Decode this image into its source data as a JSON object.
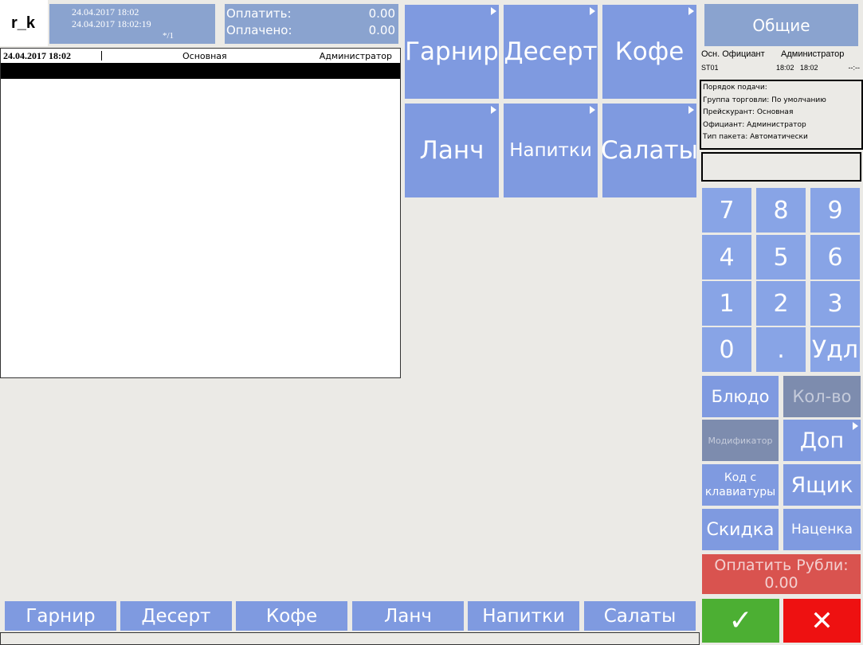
{
  "header": {
    "logo": "r_k",
    "time_opened": "24.04.2017 18:02",
    "time_current": "24.04.2017 18:02:19",
    "guests": "*/1",
    "to_pay_label": "Оплатить:",
    "to_pay_value": "0.00",
    "paid_label": "Оплачено:",
    "paid_value": "0.00"
  },
  "order": {
    "date": "24.04.2017 18:02",
    "price_list": "Основная",
    "waiter": "Администратор"
  },
  "categories": [
    "Гарнир",
    "Десерт",
    "Кофе",
    "Ланч",
    "Напитки",
    "Салаты"
  ],
  "bottom_tabs": [
    "Гарнир",
    "Десерт",
    "Кофе",
    "Ланч",
    "Напитки",
    "Салаты"
  ],
  "right": {
    "general_button": "Общие",
    "info_header": {
      "col1_title": "Осн. Официант",
      "col2_title": "Администратор",
      "table": "ST01",
      "time1": "18:02",
      "time2": "18:02",
      "dash": "--:--"
    },
    "info_lines": [
      "Порядок подачи:",
      "Группа торговли: По умолчанию",
      "Прейскурант: Основная",
      "Официант: Администратор",
      "Тип пакета: Автоматически"
    ]
  },
  "numpad": [
    "7",
    "8",
    "9",
    "4",
    "5",
    "6",
    "1",
    "2",
    "3",
    "0",
    ".",
    "Удл"
  ],
  "actions": {
    "dish": "Блюдо",
    "qty": "Кол-во",
    "modifier": "Модификатор",
    "extra": "Доп",
    "code_line1": "Код с",
    "code_line2": "клавиатуры",
    "drawer": "Ящик",
    "discount": "Скидка",
    "markup": "Наценка",
    "pay_label": "Оплатить Рубли:",
    "pay_value": "0.00",
    "ok_icon": "✓",
    "cancel_icon": "✕"
  },
  "colors": {
    "tile": "#7f9ae0",
    "pay": "#d9534f",
    "ok": "#4caf33",
    "cancel": "#ee1111"
  }
}
